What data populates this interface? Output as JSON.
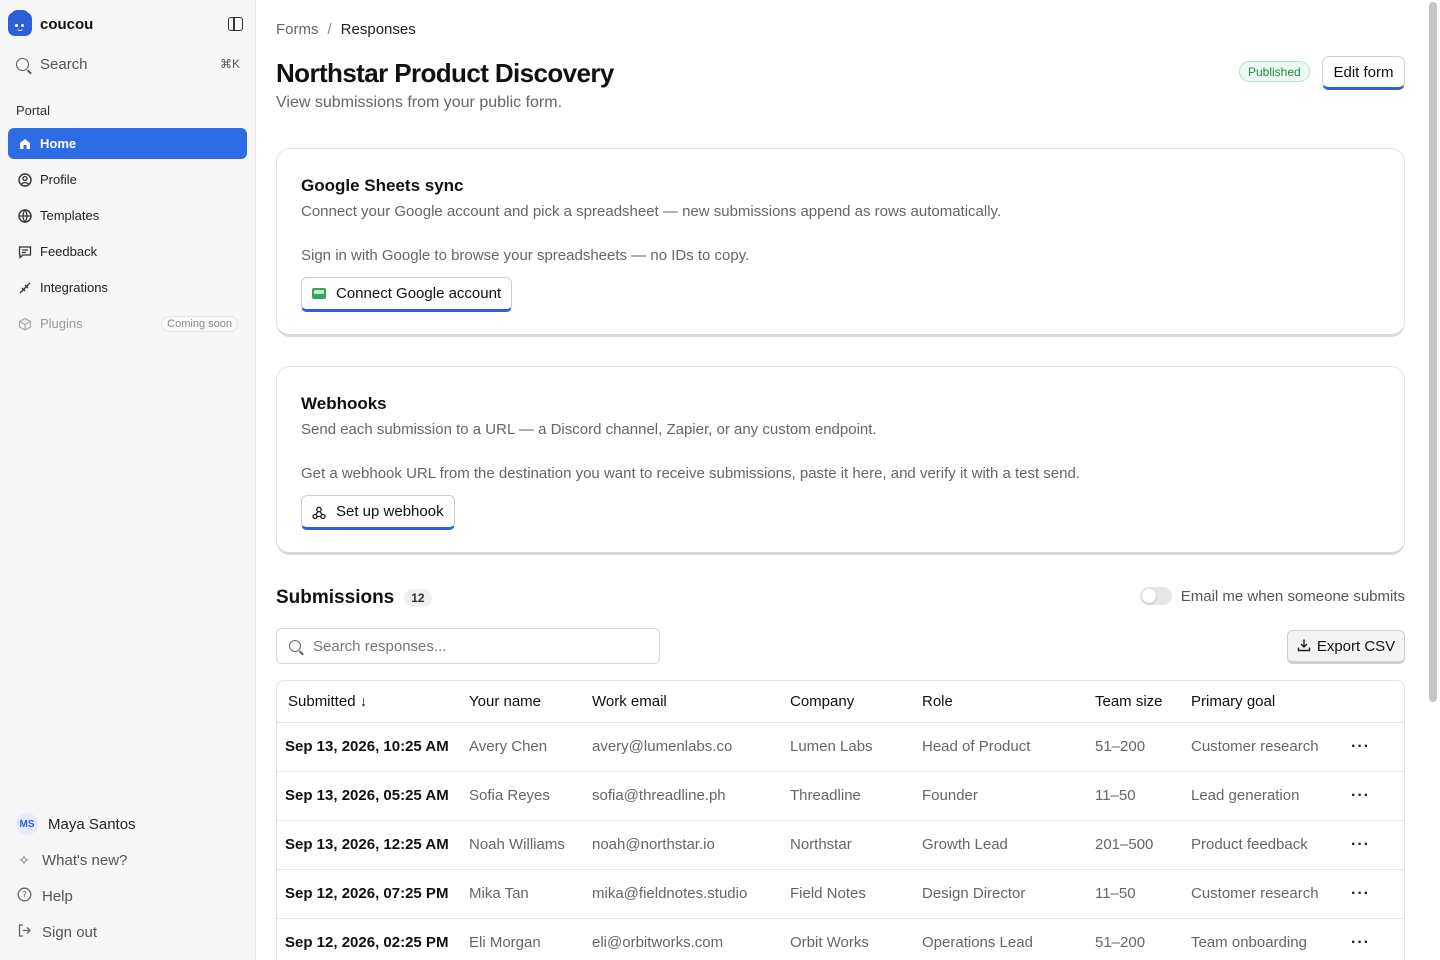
{
  "app": {
    "name": "coucou"
  },
  "search": {
    "label": "Search",
    "shortcut": "⌘K"
  },
  "sidebar": {
    "section": "Portal",
    "items": [
      {
        "label": "Home",
        "icon": "home-icon"
      },
      {
        "label": "Profile",
        "icon": "user-circle-icon"
      },
      {
        "label": "Templates",
        "icon": "globe-icon"
      },
      {
        "label": "Feedback",
        "icon": "message-icon"
      },
      {
        "label": "Integrations",
        "icon": "plug-icon"
      },
      {
        "label": "Plugins",
        "icon": "cube-icon",
        "badge": "Coming soon"
      }
    ],
    "user": {
      "initials": "MS",
      "name": "Maya Santos"
    },
    "whats_new": "What's new?",
    "help": "Help",
    "sign_out": "Sign out"
  },
  "breadcrumb": {
    "parent": "Forms",
    "separator": "/",
    "current": "Responses"
  },
  "page": {
    "title": "Northstar Product Discovery",
    "subtitle": "View submissions from your public form.",
    "status": "Published",
    "edit_label": "Edit form"
  },
  "sheets": {
    "title": "Google Sheets sync",
    "description": "Connect your Google account and pick a spreadsheet — new submissions append as rows automatically.",
    "note": "Sign in with Google to browse your spreadsheets — no IDs to copy.",
    "button": "Connect Google account"
  },
  "webhooks": {
    "title": "Webhooks",
    "description": "Send each submission to a URL — a Discord channel, Zapier, or any custom endpoint.",
    "note": "Get a webhook URL from the destination you want to receive submissions, paste it here, and verify it with a test send.",
    "button": "Set up webhook"
  },
  "submissions": {
    "title": "Submissions",
    "count": "12",
    "email_toggle_label": "Email me when someone submits",
    "email_toggle_on": false,
    "search_placeholder": "Search responses...",
    "export_label": "Export CSV",
    "columns": [
      "Submitted",
      "Your name",
      "Work email",
      "Company",
      "Role",
      "Team size",
      "Primary goal"
    ],
    "rows": [
      {
        "submitted": "Sep 13, 2026, 10:25 AM",
        "name": "Avery Chen",
        "email": "avery@lumenlabs.co",
        "company": "Lumen Labs",
        "role": "Head of Product",
        "team_size": "51–200",
        "goal": "Customer research"
      },
      {
        "submitted": "Sep 13, 2026, 05:25 AM",
        "name": "Sofia Reyes",
        "email": "sofia@threadline.ph",
        "company": "Threadline",
        "role": "Founder",
        "team_size": "11–50",
        "goal": "Lead generation"
      },
      {
        "submitted": "Sep 13, 2026, 12:25 AM",
        "name": "Noah Williams",
        "email": "noah@northstar.io",
        "company": "Northstar",
        "role": "Growth Lead",
        "team_size": "201–500",
        "goal": "Product feedback"
      },
      {
        "submitted": "Sep 12, 2026, 07:25 PM",
        "name": "Mika Tan",
        "email": "mika@fieldnotes.studio",
        "company": "Field Notes",
        "role": "Design Director",
        "team_size": "11–50",
        "goal": "Customer research"
      },
      {
        "submitted": "Sep 12, 2026, 02:25 PM",
        "name": "Eli Morgan",
        "email": "eli@orbitworks.com",
        "company": "Orbit Works",
        "role": "Operations Lead",
        "team_size": "51–200",
        "goal": "Team onboarding"
      }
    ]
  },
  "colors": {
    "accent": "#2d6ce4",
    "published_bg": "#ecf9f1",
    "published_text": "#1f8a4c"
  }
}
